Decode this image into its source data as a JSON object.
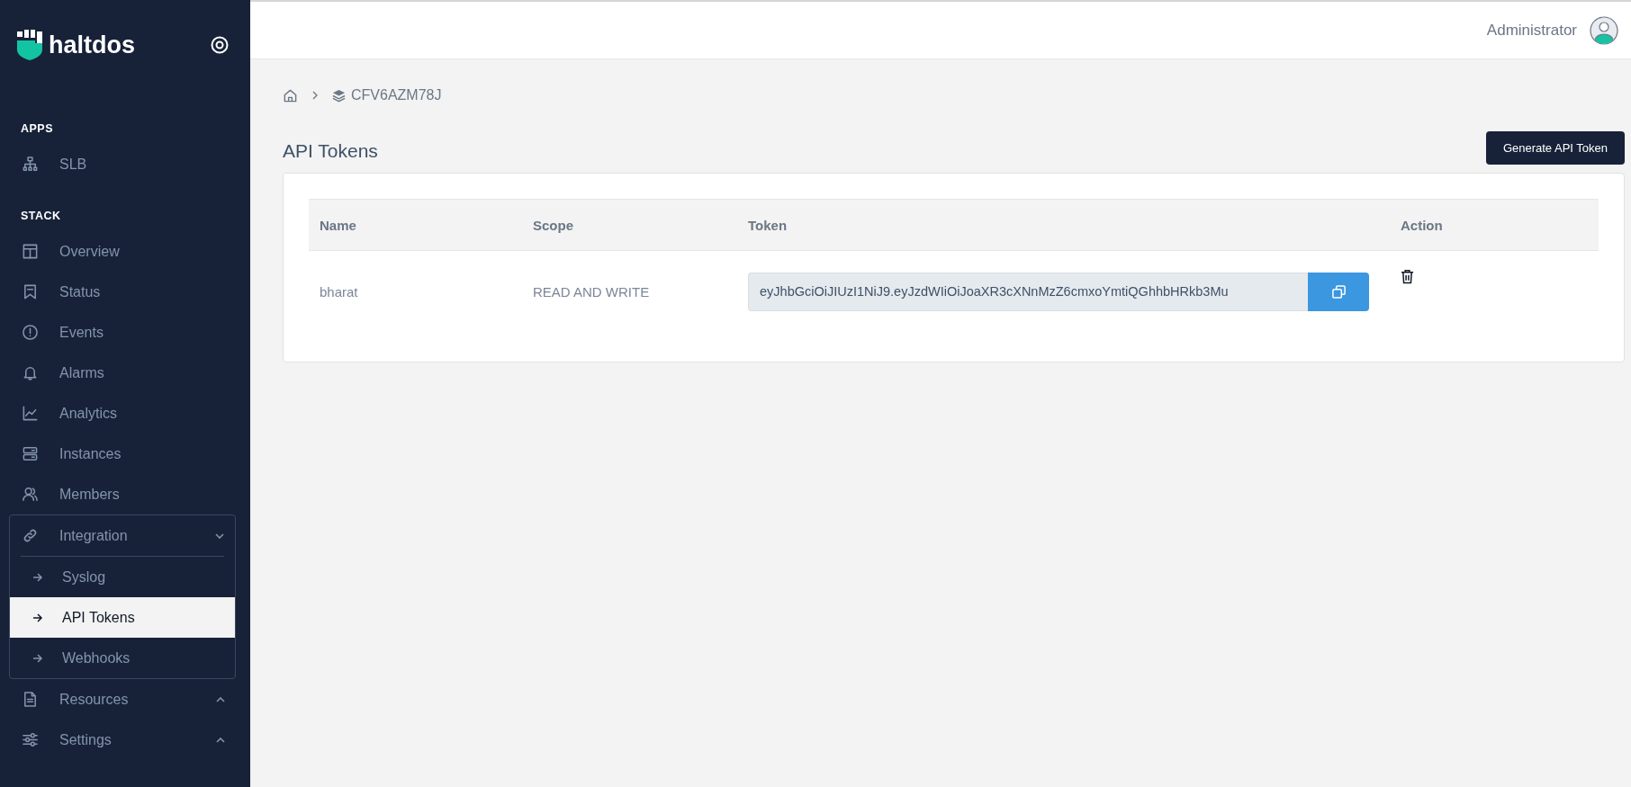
{
  "brand": {
    "name": "haltdos"
  },
  "sidebar": {
    "sections": [
      {
        "title": "APPS",
        "items": [
          {
            "label": "SLB",
            "selected": false
          }
        ]
      },
      {
        "title": "STACK",
        "items": [
          {
            "label": "Overview",
            "selected": false
          },
          {
            "label": "Status",
            "selected": false
          },
          {
            "label": "Events",
            "selected": false
          },
          {
            "label": "Alarms",
            "selected": false
          },
          {
            "label": "Analytics",
            "selected": false
          },
          {
            "label": "Instances",
            "selected": false
          },
          {
            "label": "Members",
            "selected": false
          },
          {
            "label": "Integration",
            "selected": false,
            "expanded": true,
            "children": [
              {
                "label": "Syslog",
                "selected": false
              },
              {
                "label": "API Tokens",
                "selected": true
              },
              {
                "label": "Webhooks",
                "selected": false
              }
            ]
          },
          {
            "label": "Resources",
            "selected": false,
            "expanded": false
          },
          {
            "label": "Settings",
            "selected": false,
            "expanded": false
          }
        ]
      }
    ]
  },
  "topbar": {
    "user": "Administrator"
  },
  "breadcrumb": {
    "current": "CFV6AZM78J"
  },
  "page": {
    "title": "API Tokens",
    "action": "Generate API Token"
  },
  "table": {
    "columns": [
      "Name",
      "Scope",
      "Token",
      "Action"
    ],
    "rows": [
      {
        "name": "bharat",
        "scope": "READ AND WRITE",
        "token": "eyJhbGciOiJIUzI1NiJ9.eyJzdWIiOiJoaXR3cXNnMzZ6cmxoYmtiQGhhbHRkb3Mu"
      }
    ]
  }
}
